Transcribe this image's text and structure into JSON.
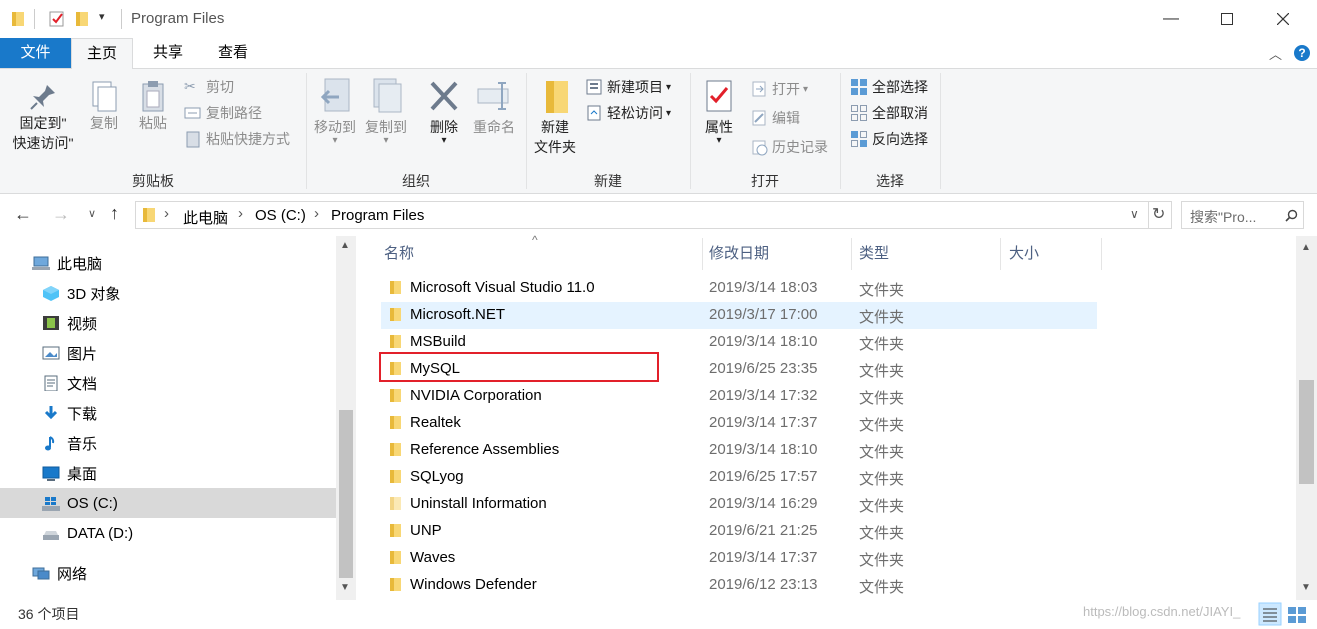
{
  "window": {
    "title": "Program Files"
  },
  "ribbon_tabs": [
    "文件",
    "主页",
    "共享",
    "查看"
  ],
  "ribbon": {
    "clipboard": {
      "pin_line1": "固定到\"",
      "pin_line2": "快速访问\"",
      "copy": "复制",
      "paste": "粘贴",
      "cut": "剪切",
      "copy_path": "复制路径",
      "paste_shortcut": "粘贴快捷方式",
      "label": "剪贴板"
    },
    "organize": {
      "move_to": "移动到",
      "copy_to": "复制到",
      "delete": "删除",
      "rename": "重命名",
      "label": "组织"
    },
    "new": {
      "new_folder_line1": "新建",
      "new_folder_line2": "文件夹",
      "new_item": "新建项目",
      "easy_access": "轻松访问",
      "label": "新建"
    },
    "open": {
      "properties": "属性",
      "open": "打开",
      "edit": "编辑",
      "history": "历史记录",
      "label": "打开"
    },
    "select": {
      "select_all": "全部选择",
      "select_none": "全部取消",
      "invert": "反向选择",
      "label": "选择"
    }
  },
  "address": {
    "crumbs": [
      "此电脑",
      "OS (C:)",
      "Program Files"
    ],
    "search_placeholder": "搜索\"Pro..."
  },
  "nav": [
    {
      "label": "此电脑",
      "icon": "computer-icon"
    },
    {
      "label": "3D 对象",
      "icon": "3d-objects-icon"
    },
    {
      "label": "视频",
      "icon": "video-icon"
    },
    {
      "label": "图片",
      "icon": "pictures-icon"
    },
    {
      "label": "文档",
      "icon": "documents-icon"
    },
    {
      "label": "下载",
      "icon": "download-icon"
    },
    {
      "label": "音乐",
      "icon": "music-icon"
    },
    {
      "label": "桌面",
      "icon": "desktop-icon"
    },
    {
      "label": "OS (C:)",
      "icon": "windows-drive-icon"
    },
    {
      "label": "DATA (D:)",
      "icon": "drive-icon"
    },
    {
      "label": "网络",
      "icon": "network-icon"
    }
  ],
  "columns": {
    "name": "名称",
    "date": "修改日期",
    "type": "类型",
    "size": "大小"
  },
  "files": [
    {
      "name": "Microsoft Visual Studio 11.0",
      "date": "2019/3/14 18:03",
      "type": "文件夹"
    },
    {
      "name": "Microsoft.NET",
      "date": "2019/3/17 17:00",
      "type": "文件夹"
    },
    {
      "name": "MSBuild",
      "date": "2019/3/14 18:10",
      "type": "文件夹"
    },
    {
      "name": "MySQL",
      "date": "2019/6/25 23:35",
      "type": "文件夹"
    },
    {
      "name": "NVIDIA Corporation",
      "date": "2019/3/14 17:32",
      "type": "文件夹"
    },
    {
      "name": "Realtek",
      "date": "2019/3/14 17:37",
      "type": "文件夹"
    },
    {
      "name": "Reference Assemblies",
      "date": "2019/3/14 18:10",
      "type": "文件夹"
    },
    {
      "name": "SQLyog",
      "date": "2019/6/25 17:57",
      "type": "文件夹"
    },
    {
      "name": "Uninstall Information",
      "date": "2019/3/14 16:29",
      "type": "文件夹"
    },
    {
      "name": "UNP",
      "date": "2019/6/21 21:25",
      "type": "文件夹"
    },
    {
      "name": "Waves",
      "date": "2019/3/14 17:37",
      "type": "文件夹"
    },
    {
      "name": "Windows Defender",
      "date": "2019/6/12 23:13",
      "type": "文件夹"
    }
  ],
  "status": {
    "count": "36 个项目",
    "watermark": "https://blog.csdn.net/JIAYI_"
  },
  "colors": {
    "accent": "#1979ca",
    "highlight_box": "#e2202a",
    "hover_row": "#e5f3ff",
    "selected_nav": "#cce8ff",
    "folder": "#f8d775"
  }
}
